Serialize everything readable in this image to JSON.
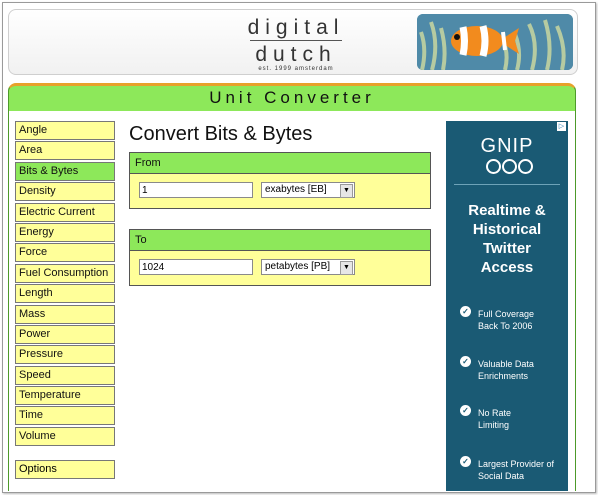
{
  "header": {
    "logo_line1": "digital",
    "logo_line2": "dutch",
    "logo_tagline": "est. 1999 amsterdam"
  },
  "title_bar": "Unit Converter",
  "sidebar": {
    "items": [
      {
        "label": "Angle"
      },
      {
        "label": "Area"
      },
      {
        "label": "Bits & Bytes",
        "active": true
      },
      {
        "label": "Density"
      },
      {
        "label": "Electric Current"
      },
      {
        "label": "Energy"
      },
      {
        "label": "Force"
      },
      {
        "label": "Fuel Consumption"
      },
      {
        "label": "Length"
      },
      {
        "label": "Mass"
      },
      {
        "label": "Power"
      },
      {
        "label": "Pressure"
      },
      {
        "label": "Speed"
      },
      {
        "label": "Temperature"
      },
      {
        "label": "Time"
      },
      {
        "label": "Volume"
      }
    ],
    "options_label": "Options"
  },
  "main": {
    "title": "Convert Bits & Bytes",
    "from": {
      "header": "From",
      "value": "1",
      "unit": "exabytes [EB]"
    },
    "to": {
      "header": "To",
      "value": "1024",
      "unit": "petabytes [PB]"
    }
  },
  "ad": {
    "brand": "GNIP",
    "info_glyph": "▷",
    "headline_lines": [
      "Realtime &",
      "Historical",
      "Twitter",
      "Access"
    ],
    "features": [
      {
        "lines": [
          "Full Coverage",
          "Back To 2006"
        ]
      },
      {
        "lines": [
          "Valuable Data",
          "Enrichments"
        ]
      },
      {
        "lines": [
          "No Rate",
          "Limiting"
        ]
      },
      {
        "lines": [
          "Largest Provider of",
          "Social Data"
        ]
      }
    ]
  },
  "colors": {
    "green": "#8de85a",
    "yellow": "#ffff99",
    "orange": "#e7a12a",
    "ad_blue": "#1a5a74"
  },
  "icons": {
    "dropdown": "chevron-down-icon",
    "check": "check-circle-icon"
  }
}
